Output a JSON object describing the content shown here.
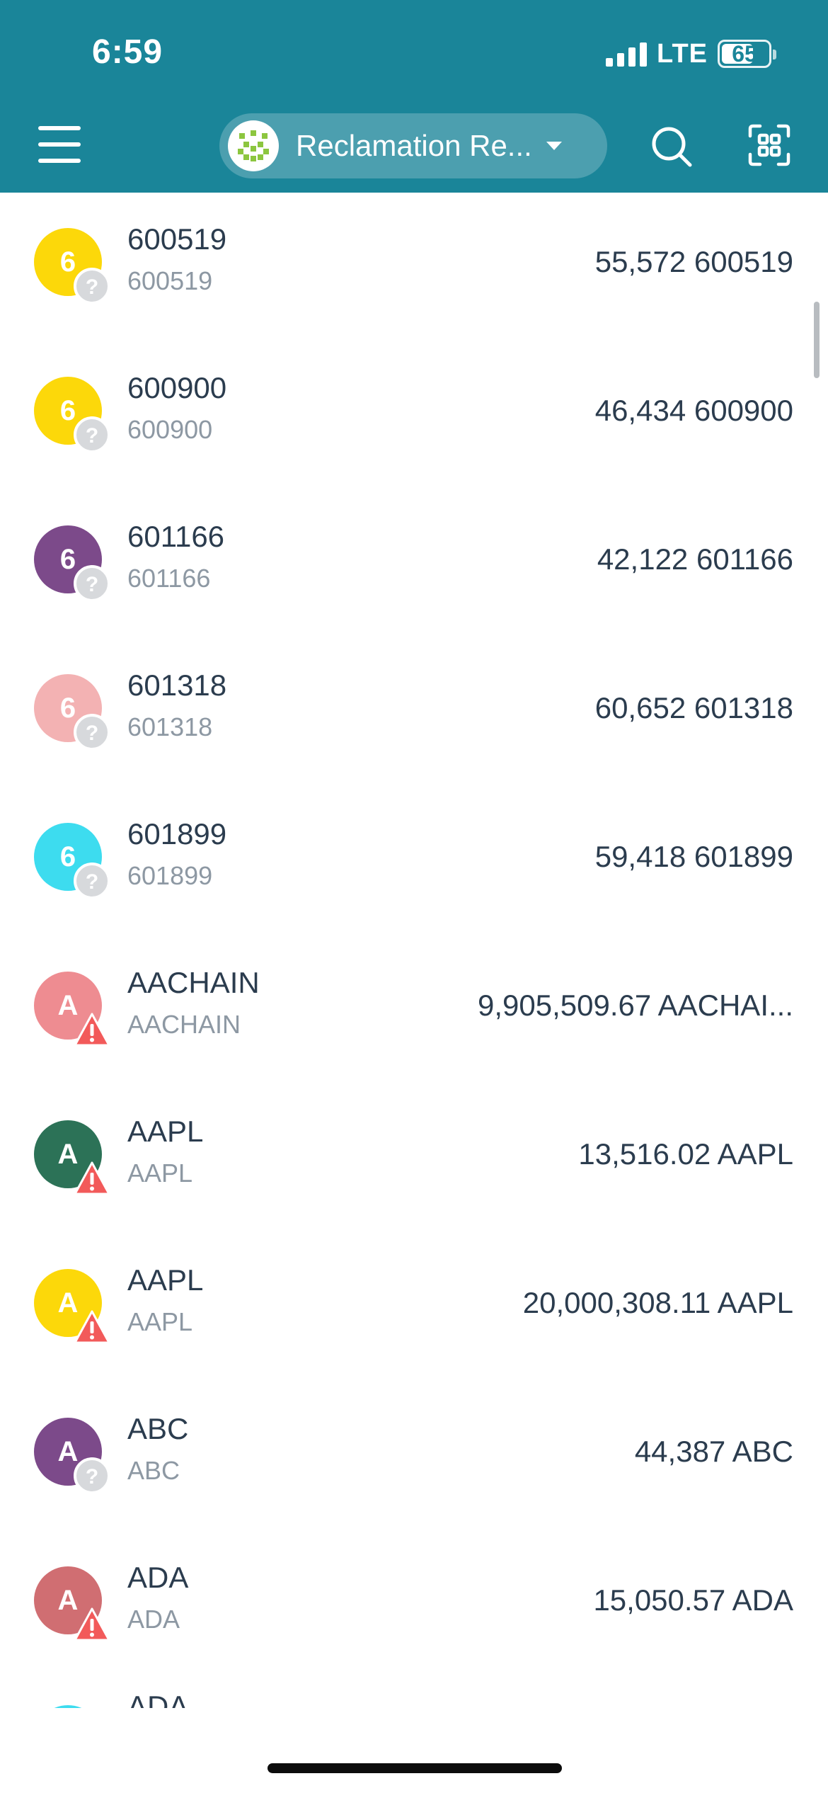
{
  "status_bar": {
    "time": "6:59",
    "network": "LTE",
    "battery": "65"
  },
  "header": {
    "wallet_name": "Reclamation Re...",
    "colors": {
      "background": "#1a8599",
      "avatar_accent": "#8cc63f"
    }
  },
  "tokens": [
    {
      "initial": "6",
      "name": "600519",
      "symbol": "600519",
      "balance": "55,572 600519",
      "color": "#fcd80a",
      "badge": "question-icon"
    },
    {
      "initial": "6",
      "name": "600900",
      "symbol": "600900",
      "balance": "46,434 600900",
      "color": "#fcd80a",
      "badge": "question-icon"
    },
    {
      "initial": "6",
      "name": "601166",
      "symbol": "601166",
      "balance": "42,122 601166",
      "color": "#7c4a8a",
      "badge": "question-icon"
    },
    {
      "initial": "6",
      "name": "601318",
      "symbol": "601318",
      "balance": "60,652 601318",
      "color": "#f3b2b3",
      "badge": "question-icon"
    },
    {
      "initial": "6",
      "name": "601899",
      "symbol": "601899",
      "balance": "59,418 601899",
      "color": "#3ddcef",
      "badge": "question-icon"
    },
    {
      "initial": "A",
      "name": "AACHAIN",
      "symbol": "AACHAIN",
      "balance": "9,905,509.67 AACHAI...",
      "color": "#ee8c91",
      "badge": "warning-icon"
    },
    {
      "initial": "A",
      "name": "AAPL",
      "symbol": "AAPL",
      "balance": "13,516.02 AAPL",
      "color": "#2c7257",
      "badge": "warning-icon"
    },
    {
      "initial": "A",
      "name": "AAPL",
      "symbol": "AAPL",
      "balance": "20,000,308.11 AAPL",
      "color": "#fcd80a",
      "badge": "warning-icon"
    },
    {
      "initial": "A",
      "name": "ABC",
      "symbol": "ABC",
      "balance": "44,387 ABC",
      "color": "#7c4a8a",
      "badge": "question-icon"
    },
    {
      "initial": "A",
      "name": "ADA",
      "symbol": "ADA",
      "balance": "15,050.57 ADA",
      "color": "#d06e72",
      "badge": "warning-icon"
    }
  ],
  "partial_token": {
    "name": "ADA",
    "color": "#3ddcef"
  }
}
